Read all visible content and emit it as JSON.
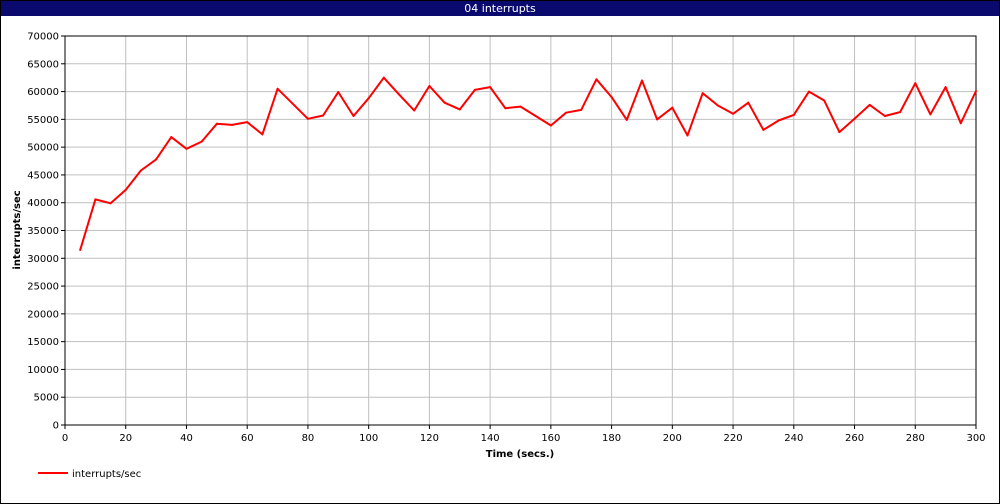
{
  "window": {
    "title": "04 interrupts"
  },
  "chart_data": {
    "type": "line",
    "title": "04 interrupts",
    "xlabel": "Time (secs.)",
    "ylabel": "interrupts/sec",
    "xlim": [
      0,
      300
    ],
    "ylim": [
      0,
      70000
    ],
    "x_ticks": [
      0,
      20,
      40,
      60,
      80,
      100,
      120,
      140,
      160,
      180,
      200,
      220,
      240,
      260,
      280,
      300
    ],
    "y_ticks": [
      0,
      5000,
      10000,
      15000,
      20000,
      25000,
      30000,
      35000,
      40000,
      45000,
      50000,
      55000,
      60000,
      65000,
      70000
    ],
    "grid": true,
    "legend_position": "bottom-left",
    "series": [
      {
        "name": "interrupts/sec",
        "color": "#ff0000",
        "x": [
          5,
          10,
          15,
          20,
          25,
          30,
          35,
          40,
          45,
          50,
          55,
          60,
          65,
          70,
          75,
          80,
          85,
          90,
          95,
          100,
          105,
          110,
          115,
          120,
          125,
          130,
          135,
          140,
          145,
          150,
          155,
          160,
          165,
          170,
          175,
          180,
          185,
          190,
          195,
          200,
          205,
          210,
          215,
          220,
          225,
          230,
          235,
          240,
          245,
          250,
          255,
          260,
          265,
          270,
          275,
          280,
          285,
          290,
          295,
          300
        ],
        "y": [
          31500,
          40600,
          39900,
          42300,
          45800,
          47800,
          51800,
          49700,
          51000,
          54200,
          54000,
          54500,
          52300,
          60500,
          57800,
          55100,
          55700,
          59900,
          55600,
          58800,
          62500,
          59500,
          56600,
          61000,
          58000,
          56800,
          60300,
          60800,
          57000,
          57300,
          55600,
          53900,
          56200,
          56700,
          62200,
          59000,
          54900,
          62000,
          55000,
          57100,
          52100,
          59700,
          57500,
          56000,
          58000,
          53100,
          54800,
          55800,
          60000,
          58400,
          52700,
          55100,
          57600,
          55600,
          56300,
          61500,
          55900,
          60800,
          54300,
          60100
        ]
      }
    ]
  }
}
